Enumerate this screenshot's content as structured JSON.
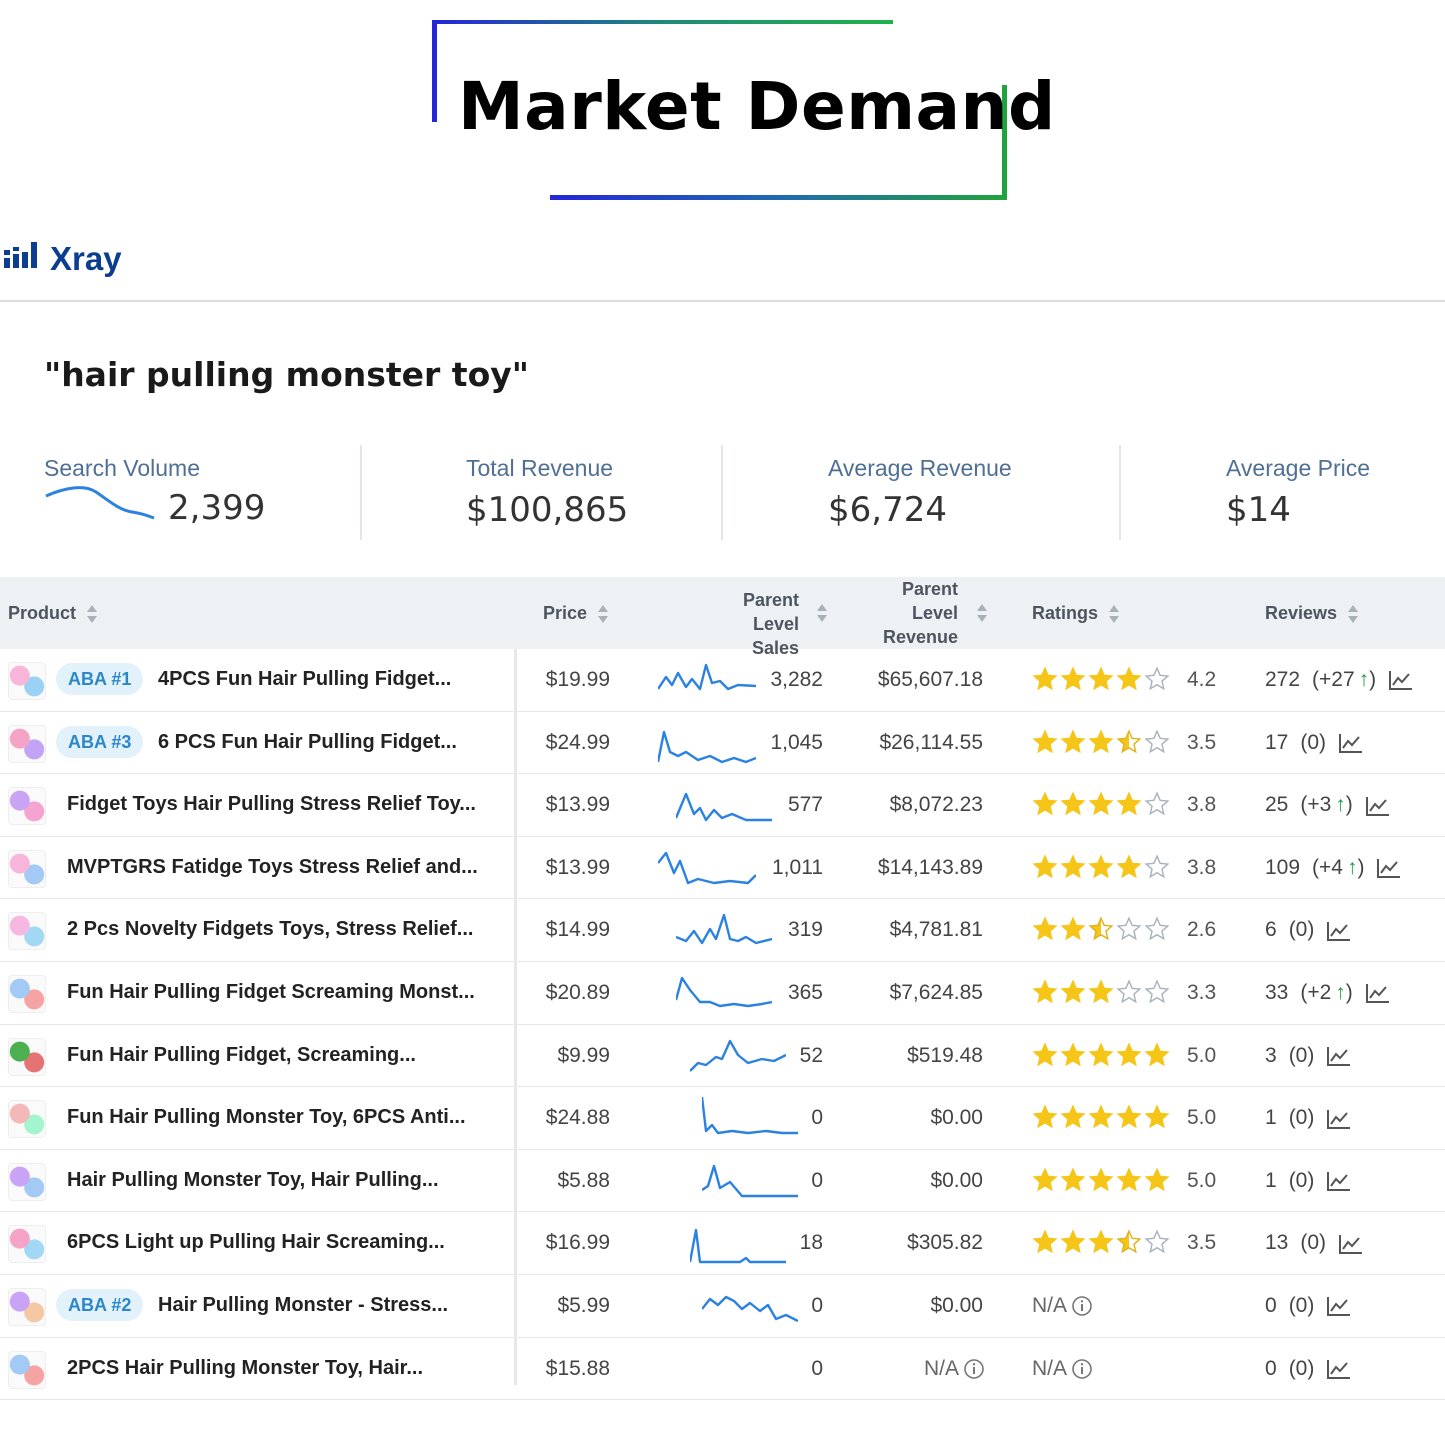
{
  "banner": {
    "title": "Market Demand"
  },
  "app": {
    "name": "Xray"
  },
  "keyword": "\"hair pulling monster toy\"",
  "stats": {
    "search_volume": {
      "label": "Search Volume",
      "value": "2,399"
    },
    "total_revenue": {
      "label": "Total Revenue",
      "value": "$100,865"
    },
    "average_revenue": {
      "label": "Average Revenue",
      "value": "$6,724"
    },
    "average_price": {
      "label": "Average Price",
      "value": "$14"
    }
  },
  "table": {
    "headers": {
      "product": "Product",
      "price": "Price",
      "sales_line1": "Parent Level",
      "sales_line2": "Sales",
      "revenue_line1": "Parent",
      "revenue_line2": "Level",
      "revenue_line3": "Revenue",
      "ratings": "Ratings",
      "reviews": "Reviews"
    },
    "rows": [
      {
        "aba": "ABA #1",
        "name": "4PCS Fun Hair Pulling Fidget...",
        "price": "$19.99",
        "sales": "3,282",
        "revenue": "$65,607.18",
        "rating": "4.2",
        "rating_value": 4.2,
        "reviews": "272",
        "delta": "(+27",
        "delta_up": true
      },
      {
        "aba": "ABA #3",
        "name": "6 PCS Fun Hair Pulling Fidget...",
        "price": "$24.99",
        "sales": "1,045",
        "revenue": "$26,114.55",
        "rating": "3.5",
        "rating_value": 3.5,
        "reviews": "17",
        "delta": "(0)",
        "delta_up": false
      },
      {
        "aba": "",
        "name": "Fidget Toys Hair Pulling Stress Relief Toy...",
        "price": "$13.99",
        "sales": "577",
        "revenue": "$8,072.23",
        "rating": "3.8",
        "rating_value": 3.8,
        "reviews": "25",
        "delta": "(+3",
        "delta_up": true
      },
      {
        "aba": "",
        "name": "MVPTGRS Fatidge Toys Stress Relief and...",
        "price": "$13.99",
        "sales": "1,011",
        "revenue": "$14,143.89",
        "rating": "3.8",
        "rating_value": 3.8,
        "reviews": "109",
        "delta": "(+4",
        "delta_up": true
      },
      {
        "aba": "",
        "name": "2 Pcs Novelty Fidgets Toys, Stress Relief...",
        "price": "$14.99",
        "sales": "319",
        "revenue": "$4,781.81",
        "rating": "2.6",
        "rating_value": 2.6,
        "reviews": "6",
        "delta": "(0)",
        "delta_up": false
      },
      {
        "aba": "",
        "name": "Fun Hair Pulling Fidget Screaming Monst...",
        "price": "$20.89",
        "sales": "365",
        "revenue": "$7,624.85",
        "rating": "3.3",
        "rating_value": 3.3,
        "reviews": "33",
        "delta": "(+2",
        "delta_up": true
      },
      {
        "aba": "",
        "name": "Fun Hair Pulling Fidget, Screaming...",
        "price": "$9.99",
        "sales": "52",
        "revenue": "$519.48",
        "rating": "5.0",
        "rating_value": 5.0,
        "reviews": "3",
        "delta": "(0)",
        "delta_up": false
      },
      {
        "aba": "",
        "name": "Fun Hair Pulling Monster Toy, 6PCS Anti...",
        "price": "$24.88",
        "sales": "0",
        "revenue": "$0.00",
        "rating": "5.0",
        "rating_value": 5.0,
        "reviews": "1",
        "delta": "(0)",
        "delta_up": false
      },
      {
        "aba": "",
        "name": "Hair Pulling Monster Toy, Hair Pulling...",
        "price": "$5.88",
        "sales": "0",
        "revenue": "$0.00",
        "rating": "5.0",
        "rating_value": 5.0,
        "reviews": "1",
        "delta": "(0)",
        "delta_up": false
      },
      {
        "aba": "",
        "name": "6PCS Light up Pulling Hair Screaming...",
        "price": "$16.99",
        "sales": "18",
        "revenue": "$305.82",
        "rating": "3.5",
        "rating_value": 3.5,
        "reviews": "13",
        "delta": "(0)",
        "delta_up": false
      },
      {
        "aba": "ABA #2",
        "name": "Hair Pulling Monster - Stress...",
        "price": "$5.99",
        "sales": "0",
        "revenue": "$0.00",
        "rating": "N/A",
        "rating_value": null,
        "reviews": "0",
        "delta": "(0)",
        "delta_up": false
      },
      {
        "aba": "",
        "name": "2PCS Hair Pulling Monster Toy, Hair...",
        "price": "$15.88",
        "sales": "0",
        "revenue": "N/A",
        "rating": "N/A",
        "rating_value": null,
        "reviews": "0",
        "delta": "(0)",
        "delta_up": false
      }
    ]
  },
  "colors": {
    "accent_blue": "#2a87c9",
    "brand_navy": "#0b3d91",
    "star_gold": "#f5c518",
    "delta_green": "#1f9a4a",
    "spark_blue": "#2b82e0"
  }
}
